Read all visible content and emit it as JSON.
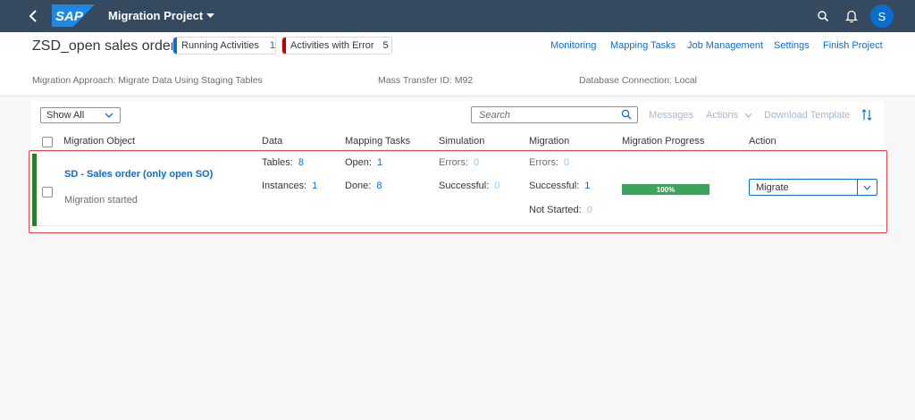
{
  "shell": {
    "brand": "SAP",
    "app_title": "Migration Project",
    "user_initial": "S"
  },
  "header": {
    "title": "ZSD_open sales order",
    "badges": [
      {
        "label": "Running Activities",
        "count": "1"
      },
      {
        "label": "Activities with Error",
        "count": "5"
      }
    ],
    "nav": [
      "Monitoring",
      "Mapping Tasks",
      "Job Management",
      "Settings",
      "Finish Project"
    ],
    "info": {
      "approach": "Migration Approach: Migrate Data Using Staging Tables",
      "mass_transfer": "Mass Transfer ID: M92",
      "db_connection": "Database Connection: Local"
    }
  },
  "toolbar": {
    "filter_value": "Show All",
    "search_placeholder": "Search",
    "messages": "Messages",
    "actions": "Actions",
    "download_template": "Download Template"
  },
  "table": {
    "columns": [
      "Migration Object",
      "Data",
      "Mapping Tasks",
      "Simulation",
      "Migration",
      "Migration Progress",
      "Action"
    ],
    "row": {
      "name": "SD - Sales order (only open SO)",
      "status": "Migration started",
      "data": {
        "tables_label": "Tables:",
        "tables": "8",
        "instances_label": "Instances:",
        "instances": "1"
      },
      "mapping": {
        "open_label": "Open:",
        "open": "1",
        "done_label": "Done:",
        "done": "8"
      },
      "simulation": {
        "errors_label": "Errors:",
        "errors": "0",
        "successful_label": "Successful:",
        "successful": "0"
      },
      "migration": {
        "errors_label": "Errors:",
        "errors": "0",
        "successful_label": "Successful:",
        "successful": "1",
        "not_started_label": "Not Started:",
        "not_started": "0"
      },
      "progress": 100,
      "progress_label": "100%",
      "action": "Migrate"
    }
  },
  "colors": {
    "shell": "#354a5f",
    "accent": "#0a6ed1",
    "error": "#bb0000",
    "success": "#3fa45b",
    "highlight": "#d94a4a"
  }
}
